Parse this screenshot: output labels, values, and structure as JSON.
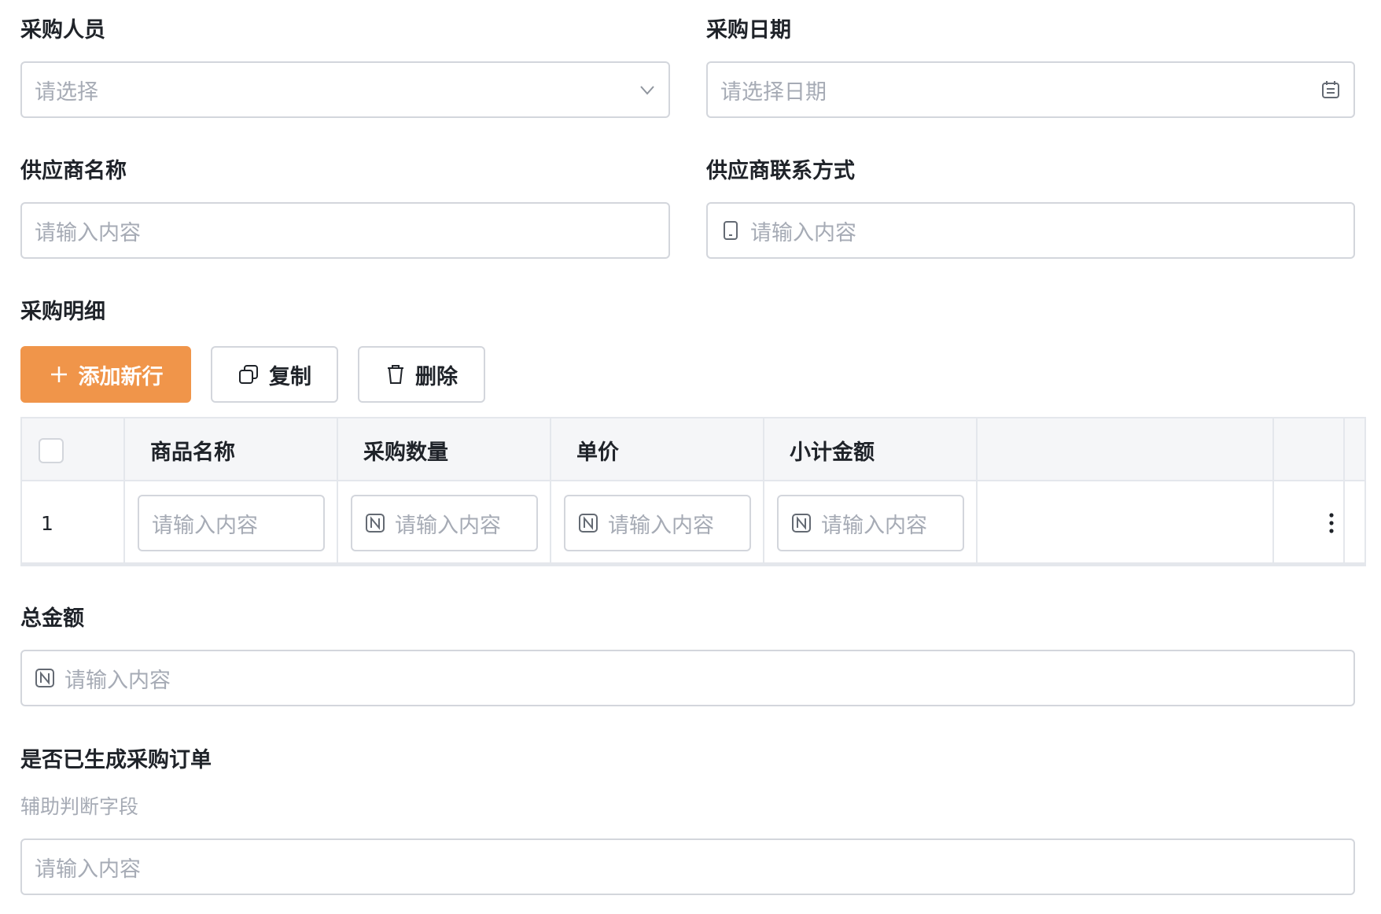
{
  "form": {
    "purchaser": {
      "label": "采购人员",
      "placeholder": "请选择"
    },
    "purchase_date": {
      "label": "采购日期",
      "placeholder": "请选择日期"
    },
    "supplier_name": {
      "label": "供应商名称",
      "placeholder": "请输入内容"
    },
    "supplier_contact": {
      "label": "供应商联系方式",
      "placeholder": "请输入内容"
    },
    "details_section": {
      "label": "采购明细"
    },
    "total_amount": {
      "label": "总金额",
      "placeholder": "请输入内容"
    },
    "order_generated": {
      "label": "是否已生成采购订单",
      "hint": "辅助判断字段",
      "placeholder": "请输入内容"
    }
  },
  "toolbar": {
    "add_row_label": "添加新行",
    "copy_label": "复制",
    "delete_label": "删除"
  },
  "table": {
    "columns": [
      "商品名称",
      "采购数量",
      "单价",
      "小计金额"
    ],
    "rows": [
      {
        "index": "1",
        "cells": [
          "请输入内容",
          "请输入内容",
          "请输入内容",
          "请输入内容"
        ]
      }
    ]
  },
  "icons": {
    "select": "chevron-down-icon",
    "date": "calendar-icon",
    "phone": "phone-icon",
    "number": "number-icon",
    "add": "plus-icon",
    "copy": "copy-icon",
    "delete": "trash-icon",
    "more": "more-vertical-icon"
  },
  "colors": {
    "primary": "#f0954a",
    "border": "#d3d6dc",
    "placeholder": "#a6abb5",
    "text": "#1f2329",
    "table_header_bg": "#f5f6f8"
  }
}
